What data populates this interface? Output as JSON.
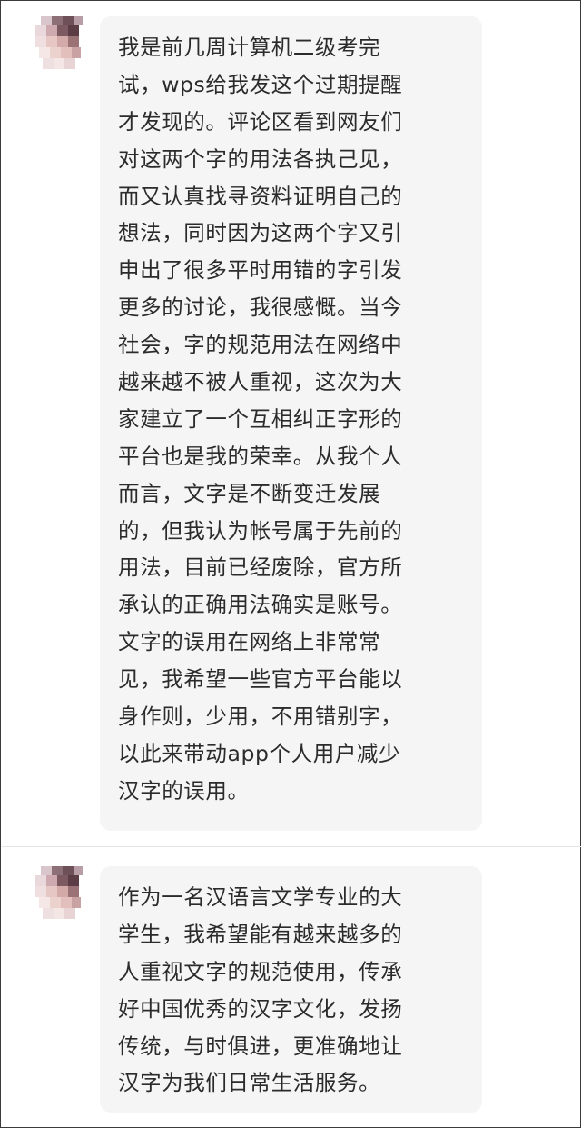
{
  "comments": [
    {
      "avatar_icon": "pixelated-user-avatar",
      "lines": [
        "我是前几周计算机二级考完",
        "试，wps给我发这个过期提醒",
        "才发现的。评论区看到网友们",
        "对这两个字的用法各执己见，",
        "而又认真找寻资料证明自己的",
        "想法，同时因为这两个字又引",
        "申出了很多平时用错的字引发",
        "更多的讨论，我很感慨。当今",
        "社会，字的规范用法在网络中",
        "越来越不被人重视，这次为大",
        "家建立了一个互相纠正字形的",
        "平台也是我的荣幸。从我个人",
        "而言，文字是不断变迁发展",
        "的，但我认为帐号属于先前的",
        "用法，目前已经废除，官方所",
        "承认的正确用法确实是账号。",
        "文字的误用在网络上非常常",
        "见，我希望一些官方平台能以",
        "身作则，少用，不用错别字，",
        "以此来带动app个人用户减少",
        "汉字的误用。"
      ]
    },
    {
      "avatar_icon": "pixelated-user-avatar",
      "lines": [
        "作为一名汉语言文学专业的大",
        "学生，我希望能有越来越多的",
        "人重视文字的规范使用，传承",
        "好中国优秀的汉字文化，发扬",
        "传统，与时俱进，更准确地让",
        "汉字为我们日常生活服务。"
      ]
    }
  ],
  "colors": {
    "bubble_bg": "#f5f5f6",
    "text": "#2b2b2b",
    "divider": "#e4e4e6",
    "frame_border": "#3a3a3a"
  }
}
